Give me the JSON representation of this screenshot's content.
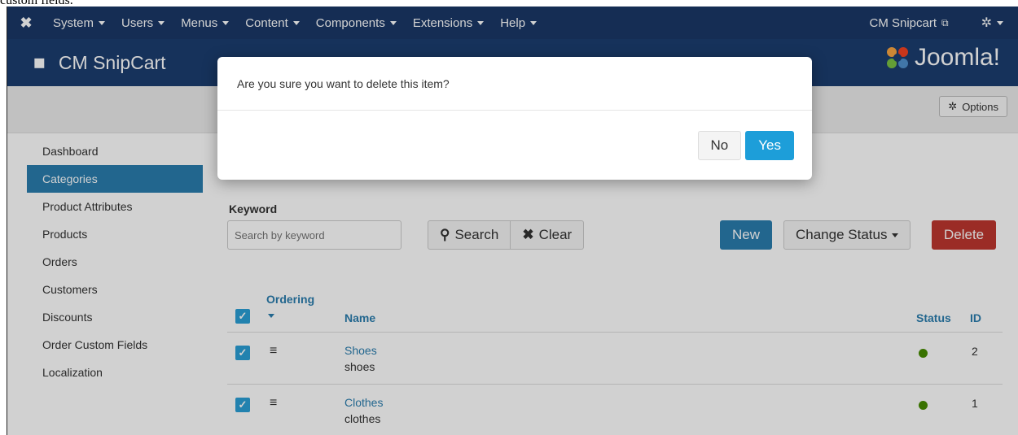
{
  "caption": "custom fields.",
  "navbar": {
    "menus": [
      "System",
      "Users",
      "Menus",
      "Content",
      "Components",
      "Extensions",
      "Help"
    ],
    "site_link": "CM Snipcart"
  },
  "header": {
    "title": "CM SnipCart",
    "logo_text": "Joomla!"
  },
  "toolbar": {
    "options_label": "Options"
  },
  "sidebar": {
    "items": [
      "Dashboard",
      "Categories",
      "Product Attributes",
      "Products",
      "Orders",
      "Customers",
      "Discounts",
      "Order Custom Fields",
      "Localization"
    ],
    "active": "Categories"
  },
  "filters": {
    "keyword_label": "Keyword",
    "keyword_placeholder": "Search by keyword",
    "search_label": "Search",
    "clear_label": "Clear"
  },
  "actions": {
    "new_label": "New",
    "change_status_label": "Change Status",
    "delete_label": "Delete"
  },
  "table": {
    "headers": {
      "ordering": "Ordering",
      "name": "Name",
      "status": "Status",
      "id": "ID"
    },
    "rows": [
      {
        "name": "Shoes",
        "alias": "shoes",
        "status": "published",
        "id": "2"
      },
      {
        "name": "Clothes",
        "alias": "clothes",
        "status": "published",
        "id": "1"
      }
    ]
  },
  "modal": {
    "message": "Are you sure you want to delete this item?",
    "no_label": "No",
    "yes_label": "Yes"
  },
  "colors": {
    "navbar": "#1a3867",
    "primary": "#2a7dae",
    "danger": "#bd362f",
    "published": "#468c00",
    "modal_yes": "#1d9ed9"
  }
}
